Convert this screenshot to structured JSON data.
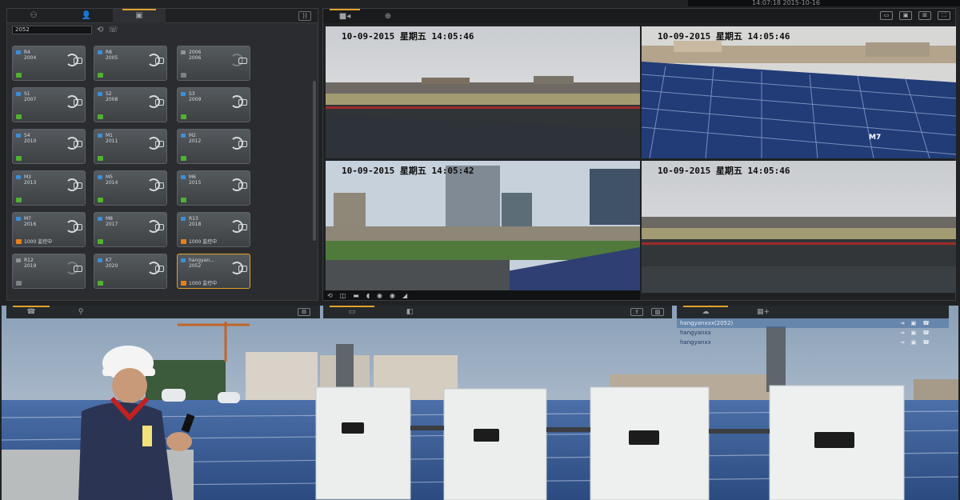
{
  "system": {
    "clock": "14:07:18 2015-10-16"
  },
  "left_panel": {
    "tabs": [
      {
        "icon": "group-icon",
        "label": "⚇"
      },
      {
        "icon": "user-icon",
        "label": "👤"
      },
      {
        "icon": "device-icon",
        "label": "▣"
      }
    ],
    "rss_label": "))",
    "search": {
      "value": "2052",
      "placeholder": ""
    },
    "devices": [
      {
        "name": "R4\n2004",
        "status": "green",
        "alarm": "",
        "dim": false
      },
      {
        "name": "R8\n2005",
        "status": "green",
        "alarm": "",
        "dim": false
      },
      {
        "name": "2006\n2006",
        "status": "gray",
        "alarm": "",
        "dim": true
      },
      {
        "name": "S1\n2007",
        "status": "green",
        "alarm": "",
        "dim": false
      },
      {
        "name": "S2\n2008",
        "status": "green",
        "alarm": "",
        "dim": false
      },
      {
        "name": "S3\n2009",
        "status": "green",
        "alarm": "",
        "dim": false
      },
      {
        "name": "S4\n2010",
        "status": "green",
        "alarm": "",
        "dim": false
      },
      {
        "name": "M1\n2011",
        "status": "green",
        "alarm": "",
        "dim": false
      },
      {
        "name": "M2\n2012",
        "status": "green",
        "alarm": "",
        "dim": false
      },
      {
        "name": "M3\n2013",
        "status": "green",
        "alarm": "",
        "dim": false
      },
      {
        "name": "M5\n2014",
        "status": "green",
        "alarm": "",
        "dim": false
      },
      {
        "name": "M6\n2015",
        "status": "green",
        "alarm": "",
        "dim": false
      },
      {
        "name": "M7\n2016",
        "status": "orange",
        "alarm": "1000  监控中",
        "dim": false
      },
      {
        "name": "M8\n2017",
        "status": "green",
        "alarm": "",
        "dim": false
      },
      {
        "name": "R13\n2018",
        "status": "orange",
        "alarm": "1000  监控中",
        "dim": false
      },
      {
        "name": "R12\n2019",
        "status": "gray",
        "alarm": "",
        "dim": true
      },
      {
        "name": "K7\n2020",
        "status": "green",
        "alarm": "",
        "dim": false
      },
      {
        "name": "hangyan...\n2052",
        "status": "orange",
        "alarm": "1000  监控中",
        "dim": false,
        "selected": true
      }
    ]
  },
  "video_panel": {
    "tabs": [
      {
        "icon": "video-camera-icon",
        "label": "■◂"
      },
      {
        "icon": "add-icon",
        "label": "⊕"
      }
    ],
    "tools": [
      "▭",
      "▣",
      "⊞",
      "⛶"
    ],
    "tiles": [
      {
        "osd": "10-09-2015  星期五  14:05:46",
        "tag": ""
      },
      {
        "osd": "10-09-2015  星期五  14:05:46",
        "tag": "M7"
      },
      {
        "osd": "10-09-2015  星期五  14:05:42",
        "tag": ""
      },
      {
        "osd": "10-09-2015  星期五  14:05:46",
        "tag": ""
      }
    ],
    "bar_icons": [
      "⟲",
      "◫",
      "▬",
      "◖",
      "◉",
      "◉",
      "◢"
    ]
  },
  "bottom": {
    "left_tabs": [
      "☎",
      "⚲"
    ],
    "mid_tabs": [
      "▭",
      "◧"
    ],
    "right_tabs": [
      "☁",
      "▦+"
    ],
    "contacts": [
      {
        "name": "hangyanxxx(2052)",
        "selected": true
      },
      {
        "name": "hangyanxx",
        "selected": false
      },
      {
        "name": "hangyanxx",
        "selected": false
      }
    ],
    "contact_icons": [
      "⇥",
      "▣",
      "☎"
    ]
  }
}
